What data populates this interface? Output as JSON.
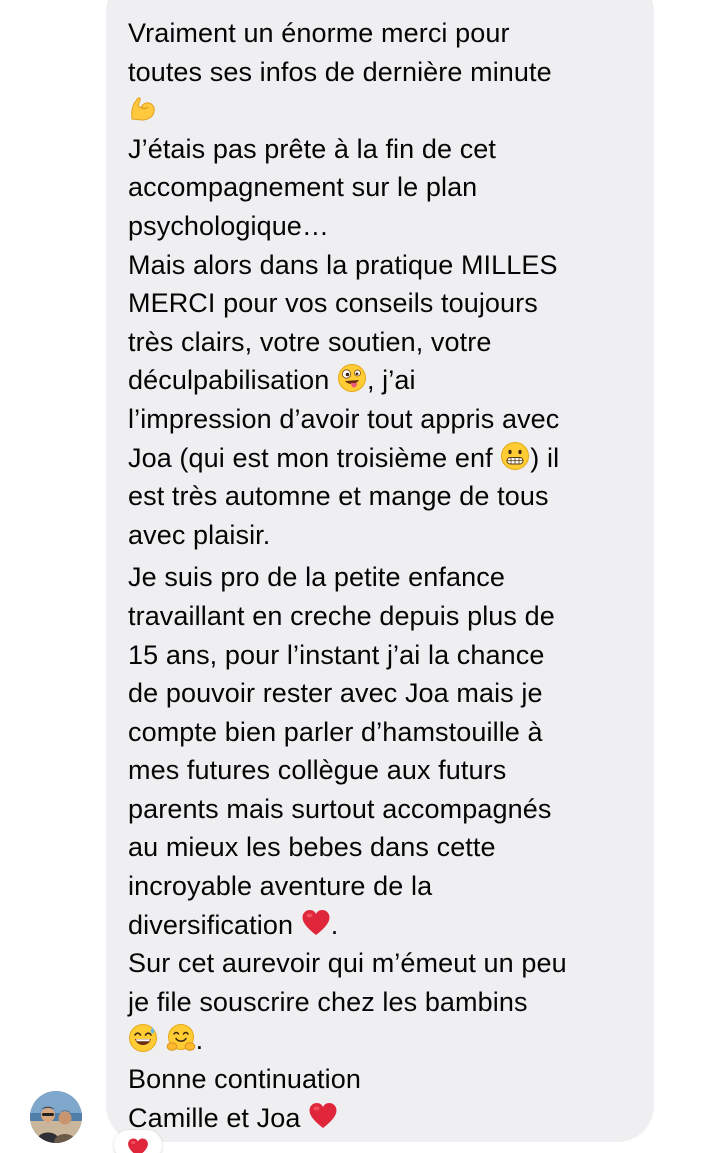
{
  "message": {
    "lines": [
      "Vraiment un énorme merci pour",
      "toutes ses infos de dernière minute",
      "J’étais pas prête à la fin de cet",
      "accompagnement sur le plan",
      "psychologique…",
      "Mais alors dans la pratique MILLES",
      "MERCI pour vos conseils toujours",
      "très clairs, votre soutien, votre",
      "déculpabilisation",
      ", j’ai",
      "l’impression d’avoir tout appris avec",
      "Joa (qui est mon troisième enf",
      ") il",
      "est très automne et mange de tous",
      "avec plaisir.",
      "Je suis pro de la petite enfance",
      "travaillant en creche depuis plus de",
      "15 ans, pour l’instant j’ai la chance",
      "de pouvoir rester avec Joa mais je",
      "compte bien parler d’hamstouille à",
      "mes futures collègue aux futurs",
      "parents mais surtout accompagnés",
      "au mieux les bebes dans cette",
      "incroyable aventure de la",
      "diversification",
      ".",
      "Sur cet aurevoir qui m’émeut un peu",
      "je file souscrire chez les bambins",
      ".",
      "Bonne continuation",
      "Camille et Joa"
    ]
  },
  "emojis": {
    "flexed_biceps": "flexed-biceps-icon",
    "zany_face": "zany-face-icon",
    "grimacing_face": "grimacing-face-icon",
    "red_heart": "red-heart-icon",
    "sweat_smile": "grinning-sweat-face-icon",
    "hugging_face": "hugging-face-icon"
  },
  "reaction": {
    "emoji": "red-heart-icon"
  },
  "colors": {
    "bubble": "#efeff1",
    "text": "#050505",
    "heart": "#e0263a",
    "emoji_yellow": "#ffcc33"
  }
}
